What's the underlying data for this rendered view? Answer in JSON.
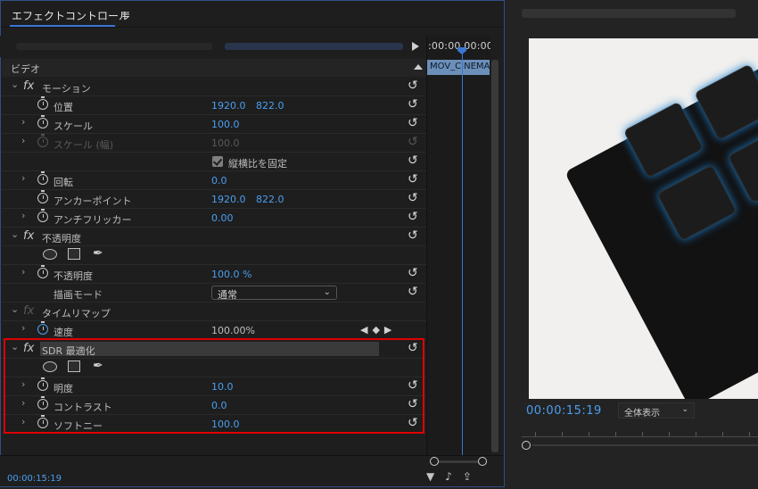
{
  "effect_controls": {
    "panel_title": "エフェクトコントロール",
    "menu_icon": "hamburger-icon",
    "timeline_timecode": ":00:00 00:00",
    "clip_name": "MOV_CINEMA",
    "section_header": "ビデオ",
    "rows": {
      "motion_label": "モーション",
      "position_label": "位置",
      "position_x": "1920.0",
      "position_y": "822.0",
      "scale_label": "スケール",
      "scale_value": "100.0",
      "scale_width_label": "スケール (幅)",
      "scale_width_value": "100.0",
      "uniform_scale_label": "縦横比を固定",
      "uniform_scale_checked": true,
      "rotation_label": "回転",
      "rotation_value": "0.0",
      "anchor_label": "アンカーポイント",
      "anchor_x": "1920.0",
      "anchor_y": "822.0",
      "antiflicker_label": "アンチフリッカー",
      "antiflicker_value": "0.00",
      "opacity_section_label": "不透明度",
      "opacity_label": "不透明度",
      "opacity_value": "100.0 %",
      "blend_mode_label": "描画モード",
      "blend_mode_value": "通常",
      "time_remap_label": "タイムリマップ",
      "speed_label": "速度",
      "speed_value": "100.00%",
      "sdr_label": "SDR 最適化",
      "brightness_label": "明度",
      "brightness_value": "10.0",
      "contrast_label": "コントラスト",
      "contrast_value": "0.0",
      "softness_label": "ソフトニー",
      "softness_value": "100.0"
    },
    "footer_timecode": "00:00:15:19"
  },
  "program_monitor": {
    "timecode": "00:00:15:19",
    "fit_value": "全体表示"
  },
  "colors": {
    "accent_blue": "#4a9ff0",
    "highlight_red": "#e00000",
    "panel_bg": "#1e1e1e"
  }
}
